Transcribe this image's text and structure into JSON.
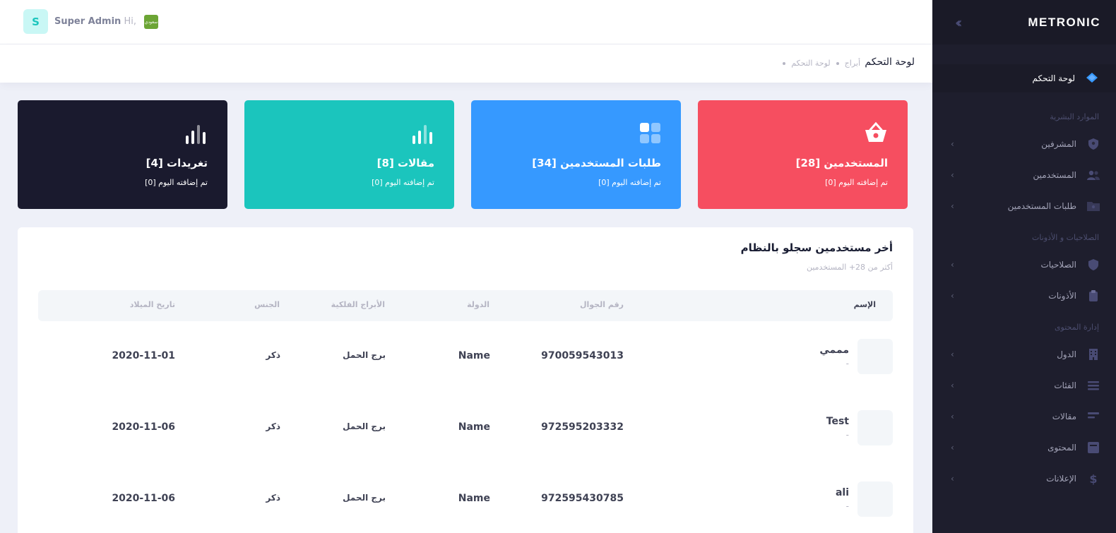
{
  "app": {
    "brand": "METRONIC"
  },
  "header": {
    "avatar_letter": "S",
    "greeting_prefix": "Hi,",
    "user_name": "Super Admin",
    "flag_text": "سعودي"
  },
  "subheader": {
    "title": "لوحة التحكم",
    "breadcrumbs": [
      "أبراج",
      "لوحة التحكم"
    ]
  },
  "sidebar": {
    "dashboard": {
      "label": "لوحة التحكم",
      "icon": "layers-icon"
    },
    "sections": [
      {
        "title": "الموارد البشرية",
        "items": [
          {
            "label": "المشرفين",
            "icon": "shield-user-icon"
          },
          {
            "label": "المستخدمين",
            "icon": "group-icon"
          },
          {
            "label": "طلبات المستخدمين",
            "icon": "folder-user-icon"
          }
        ]
      },
      {
        "title": "الصلاحيات و الأذونات",
        "items": [
          {
            "label": "الصلاحيات",
            "icon": "shield-check-icon"
          },
          {
            "label": "الأذونات",
            "icon": "clipboard-icon"
          }
        ]
      },
      {
        "title": "إدارة المحتوى",
        "items": [
          {
            "label": "الدول",
            "icon": "building-icon"
          },
          {
            "label": "الفئات",
            "icon": "list-icon"
          },
          {
            "label": "مقالات",
            "icon": "article-icon"
          },
          {
            "label": "المحتوى",
            "icon": "file-icon"
          },
          {
            "label": "الإعلانات",
            "icon": "dollar-icon"
          }
        ]
      }
    ]
  },
  "cards": [
    {
      "title": "المستخدمين [28]",
      "sub": "تم إضافته اليوم [0]",
      "color": "#f64e60",
      "icon": "basket-icon"
    },
    {
      "title": "طلبات المستخدمين [34]",
      "sub": "تم إضافته اليوم [0]",
      "color": "#3699ff",
      "icon": "grid-icon"
    },
    {
      "title": "مقالات [8]",
      "sub": "تم إضافته اليوم [0]",
      "color": "#1bc5bd",
      "icon": "bars-chart-icon"
    },
    {
      "title": "تغريدات [4]",
      "sub": "تم إضافته اليوم [0]",
      "color": "#1a1a2e",
      "icon": "bars-chart-icon"
    }
  ],
  "users_table": {
    "title": "أخر مستخدمين سجلو بالنظام",
    "subtitle": "أكثر من 28+ المستخدمين",
    "columns": {
      "name": "الإسم",
      "phone": "رقم الجوال",
      "country": "الدولة",
      "zodiac": "الأبراج الفلكية",
      "gender": "الجنس",
      "birthdate": "تاريخ الميلاد"
    },
    "rows": [
      {
        "name": "مممي",
        "sub": "-",
        "phone": "970059543013",
        "country": "Name",
        "zodiac": "برج الحمل",
        "gender": "ذكر",
        "birthdate": "2020-11-01"
      },
      {
        "name": "Test",
        "sub": "-",
        "phone": "972595203332",
        "country": "Name",
        "zodiac": "برج الحمل",
        "gender": "ذكر",
        "birthdate": "2020-11-06"
      },
      {
        "name": "ali",
        "sub": "-",
        "phone": "972595430785",
        "country": "Name",
        "zodiac": "برج الحمل",
        "gender": "ذكر",
        "birthdate": "2020-11-06"
      }
    ]
  }
}
